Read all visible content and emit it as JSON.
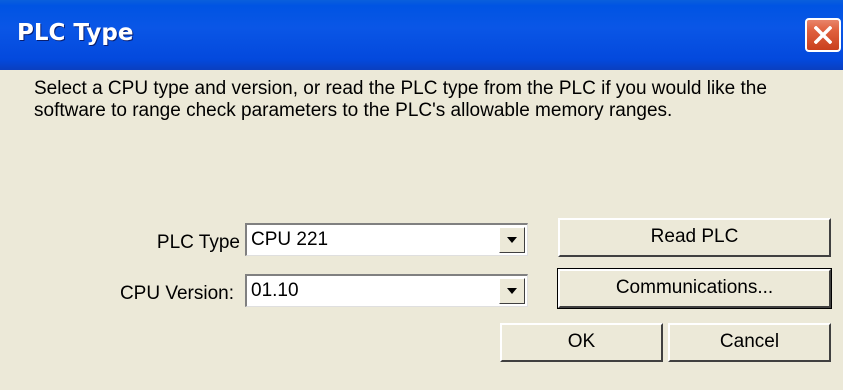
{
  "window": {
    "title": "PLC Type"
  },
  "description": "Select a CPU type and version, or read the PLC type from the PLC if you would like the software to range check parameters to the PLC's allowable memory ranges.",
  "fields": {
    "plc_type": {
      "label": "PLC Type",
      "value": "CPU 221"
    },
    "cpu_version": {
      "label": "CPU Version:",
      "value": "01.10"
    }
  },
  "buttons": {
    "read_plc": "Read PLC",
    "communications": "Communications...",
    "ok": "OK",
    "cancel": "Cancel"
  },
  "icons": {
    "close": "close-icon",
    "dropdown": "chevron-down-icon"
  },
  "colors": {
    "titlebar": "#0054e3",
    "dialog_bg": "#ece9d8",
    "close_button": "#e0603e"
  }
}
